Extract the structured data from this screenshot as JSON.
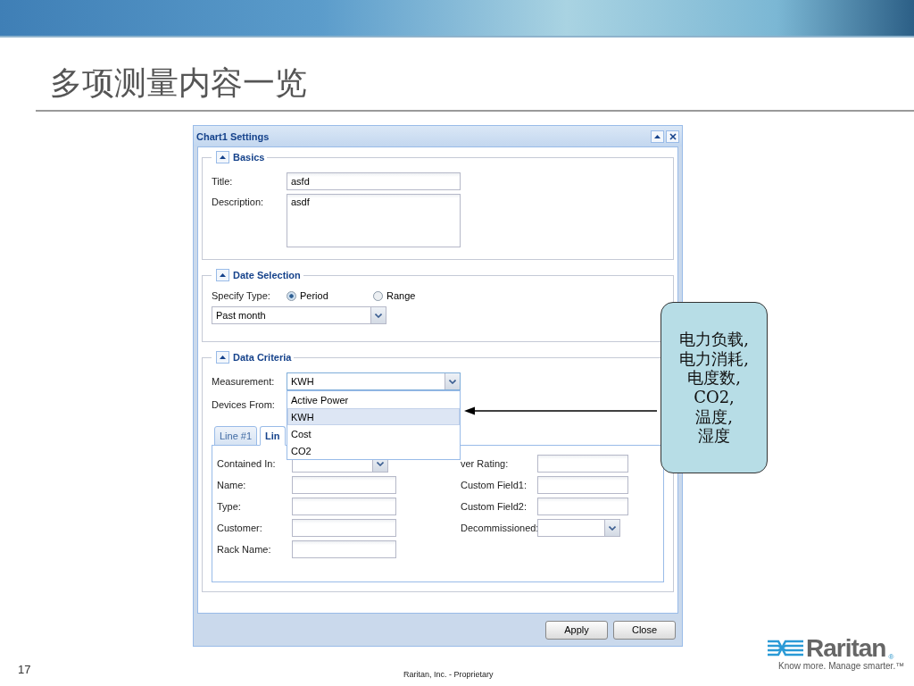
{
  "slide": {
    "title": "多项测量内容一览",
    "page_number": "17",
    "footer": "Raritan, Inc. - Proprietary",
    "logo": {
      "name": "Raritan",
      "mark": "®",
      "tagline": "Know more. Manage smarter.™"
    }
  },
  "dialog": {
    "title": "Chart1 Settings",
    "basics": {
      "legend": "Basics",
      "expanded": true,
      "title": {
        "label": "Title:",
        "value": "asfd"
      },
      "description": {
        "label": "Description:",
        "value": "asdf"
      }
    },
    "date_selection": {
      "legend": "Date Selection",
      "expanded": true,
      "specify_type": {
        "label": "Specify Type:",
        "options": [
          {
            "label": "Period",
            "selected": true
          },
          {
            "label": "Range",
            "selected": false
          }
        ]
      },
      "period": {
        "value": "Past month"
      }
    },
    "data_criteria": {
      "legend": "Data Criteria",
      "expanded": true,
      "measurement": {
        "label": "Measurement:",
        "value": "KWH",
        "expanded": true,
        "options": [
          {
            "label": "Active Power",
            "selected": false
          },
          {
            "label": "KWH",
            "selected": true
          },
          {
            "label": "Cost",
            "selected": false
          },
          {
            "label": "CO2",
            "selected": false
          }
        ]
      },
      "devices_from": {
        "label": "Devices From:"
      },
      "tabs": [
        {
          "label": "Line #1",
          "selected": false
        },
        {
          "label": "Lin",
          "selected": true
        }
      ],
      "fields_left": [
        {
          "label": "Contained In:",
          "kind": "select"
        },
        {
          "label": "Name:",
          "kind": "text"
        },
        {
          "label": "Type:",
          "kind": "text"
        },
        {
          "label": "Customer:",
          "kind": "text"
        },
        {
          "label": "Rack Name:",
          "kind": "text"
        }
      ],
      "fields_right": [
        {
          "label": "ver Rating:",
          "kind": "text"
        },
        {
          "label": "Custom Field1:",
          "kind": "text"
        },
        {
          "label": "Custom Field2:",
          "kind": "text"
        },
        {
          "label": "Decommissioned:",
          "kind": "select"
        }
      ]
    },
    "buttons": [
      {
        "label": "Apply"
      },
      {
        "label": "Close"
      }
    ]
  },
  "callout": {
    "lines": [
      "电力负载,",
      "电力消耗,",
      "电度数,",
      "CO2,",
      "温度,",
      "湿度"
    ]
  }
}
